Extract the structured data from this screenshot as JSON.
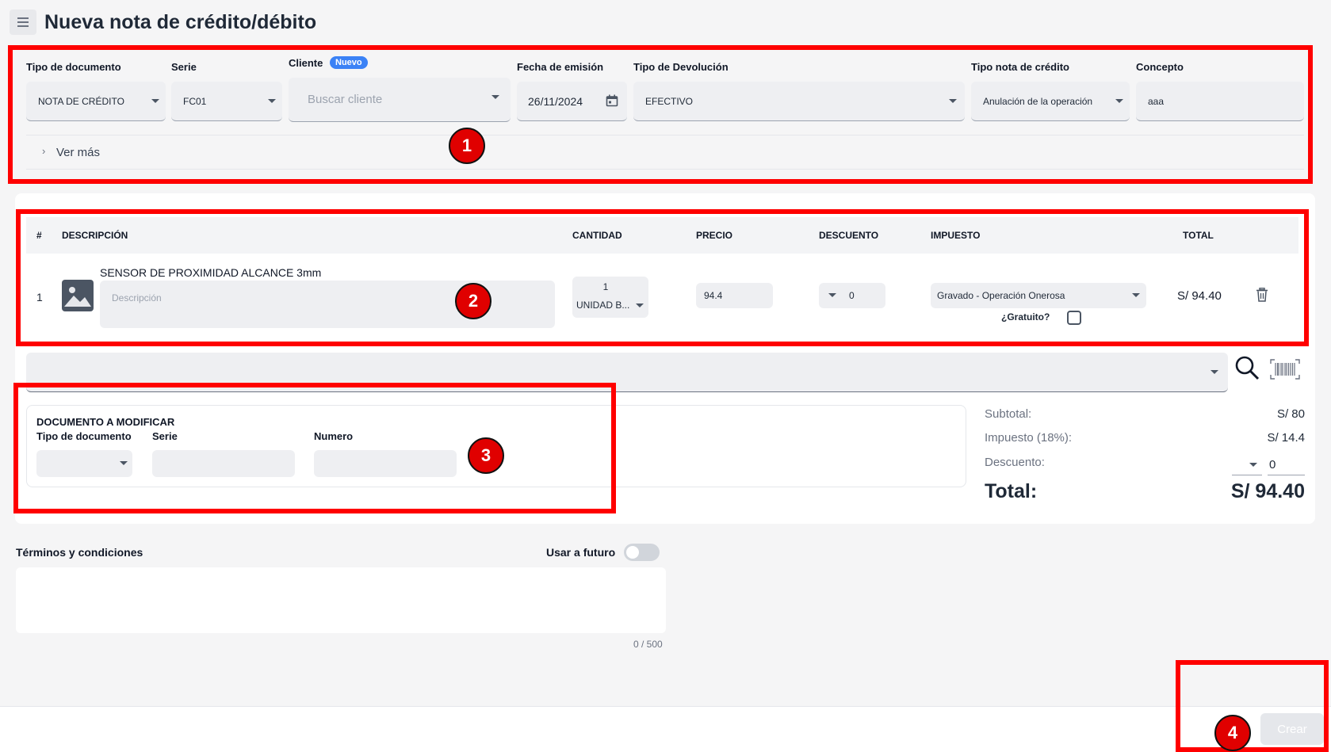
{
  "header": {
    "title": "Nueva nota de crédito/débito"
  },
  "form": {
    "tipo_documento": {
      "label": "Tipo de documento",
      "value": "NOTA DE CRÉDITO"
    },
    "serie": {
      "label": "Serie",
      "value": "FC01"
    },
    "cliente": {
      "label": "Cliente",
      "badge": "Nuevo",
      "placeholder": "Buscar cliente"
    },
    "fecha_emision": {
      "label": "Fecha de emisión",
      "value": "26/11/2024"
    },
    "tipo_devolucion": {
      "label": "Tipo de Devolución",
      "value": "EFECTIVO"
    },
    "tipo_nota": {
      "label": "Tipo nota de crédito",
      "value": "Anulación de la operación"
    },
    "concepto": {
      "label": "Concepto",
      "value": "aaa"
    },
    "ver_mas": "Ver más"
  },
  "table": {
    "headers": {
      "num": "#",
      "descripcion": "DESCRIPCIÓN",
      "cantidad": "CANTIDAD",
      "precio": "PRECIO",
      "descuento": "DESCUENTO",
      "impuesto": "IMPUESTO",
      "total": "TOTAL"
    },
    "rows": [
      {
        "num": "1",
        "producto": "SENSOR DE PROXIMIDAD ALCANCE 3mm",
        "descripcion_placeholder": "Descripción",
        "cantidad": "1",
        "unidad": "UNIDAD B...",
        "precio": "94.4",
        "descuento": "0",
        "impuesto": "Gravado - Operación Onerosa",
        "gratuito_label": "¿Gratuito?",
        "total": "S/ 94.40"
      }
    ]
  },
  "doc_modificar": {
    "title": "DOCUMENTO A MODIFICAR",
    "tipo_label": "Tipo de documento",
    "serie_label": "Serie",
    "numero_label": "Numero"
  },
  "totals": {
    "subtotal_label": "Subtotal:",
    "subtotal": "S/ 80",
    "impuesto_label": "Impuesto (18%):",
    "impuesto": "S/ 14.4",
    "descuento_label": "Descuento:",
    "descuento": "0",
    "total_label": "Total:",
    "total": "S/ 94.40"
  },
  "terms": {
    "label": "Términos y condiciones",
    "usar_futuro": "Usar a futuro",
    "counter": "0 / 500"
  },
  "footer": {
    "crear": "Crear"
  },
  "markers": [
    "1",
    "2",
    "3",
    "4"
  ],
  "colors": {
    "annotation": "#ff0000",
    "badge": "#3b82f6",
    "field_bg": "#eeeff2"
  }
}
